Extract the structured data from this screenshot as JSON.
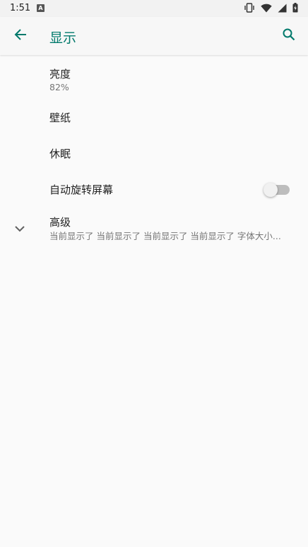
{
  "status_bar": {
    "time": "1:51",
    "badge": "A",
    "icons": [
      "vibrate-icon",
      "wifi-icon",
      "signal-icon",
      "battery-icon"
    ]
  },
  "app_bar": {
    "title": "显示",
    "back_icon": "arrow-back-icon",
    "search_icon": "search-icon",
    "accent_color": "#00796b"
  },
  "settings": {
    "brightness": {
      "title": "亮度",
      "summary": "82%"
    },
    "wallpaper": {
      "title": "壁纸"
    },
    "sleep": {
      "title": "休眠"
    },
    "auto_rotate": {
      "title": "自动旋转屏幕",
      "enabled": false
    },
    "advanced": {
      "title": "高级",
      "summary": "当前显示了 当前显示了 当前显示了 当前显示了 字体大小..."
    }
  }
}
